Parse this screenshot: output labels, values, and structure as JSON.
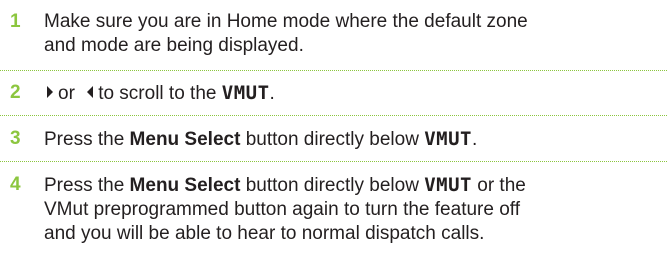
{
  "steps": [
    {
      "number": "1",
      "lines": [
        "Make sure you are in Home mode where the default zone",
        "and mode are being displayed."
      ]
    },
    {
      "number": "2",
      "conj": "or",
      "text_before": "to scroll to the",
      "key": "VMUT",
      "text_after": "."
    },
    {
      "number": "3",
      "prefix": "Press the",
      "button_name": "Menu Select",
      "middle": "button directly below",
      "key": "VMUT",
      "suffix": "."
    },
    {
      "number": "4",
      "prefix": "Press the",
      "button_name": "Menu Select",
      "middle": "button directly below",
      "key": "VMUT",
      "line1_end": "or the",
      "line2": "VMut preprogrammed button again to turn the feature off",
      "line3": "and you will be able to hear to normal dispatch calls."
    }
  ],
  "colors": {
    "accent": "#8cc63f",
    "text": "#231f20"
  },
  "icons": [
    "right-arrow-icon",
    "left-arrow-icon"
  ]
}
